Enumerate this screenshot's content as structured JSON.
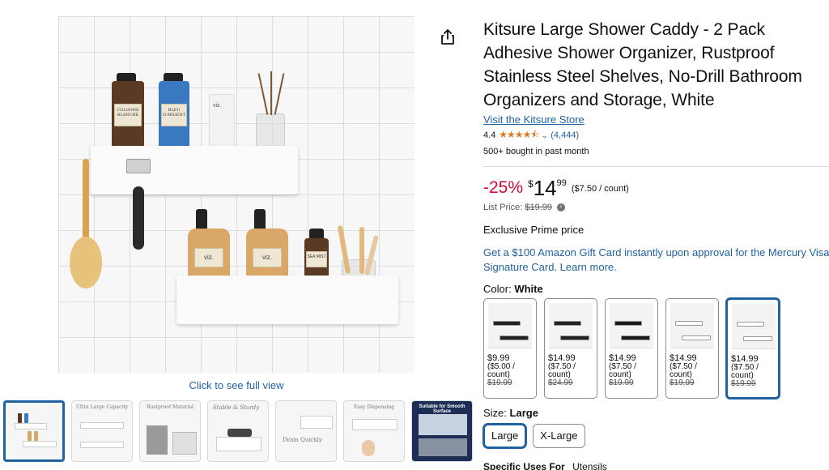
{
  "product": {
    "title": "Kitsure Large Shower Caddy - 2 Pack Adhesive Shower Organizer, Rustproof Stainless Steel Shelves, No-Drill Bathroom Organizers and Storage, White",
    "store_link": "Visit the Kitsure Store",
    "rating": "4.4",
    "stars_icon": "★★★★⯪",
    "rating_count": "(4,444)",
    "bought": "500+ bought in past month"
  },
  "price": {
    "discount": "-25%",
    "currency": "$",
    "whole": "14",
    "fraction": "99",
    "per_unit": "($7.50 / count)",
    "list_label": "List Price:",
    "list_value": "$19.99",
    "prime": "Exclusive Prime price"
  },
  "gift_card": "Get a $100 Amazon Gift Card instantly upon approval for the Mercury Visa Signature Card. Learn more.",
  "color": {
    "label": "Color:",
    "selected": "White",
    "options": [
      {
        "price": "$9.99",
        "unit": "($5.00 /",
        "unit2": "count)",
        "list": "$19.99",
        "shelf_color": "#222222"
      },
      {
        "price": "$14.99",
        "unit": "($7.50 /",
        "unit2": "count)",
        "list": "$24.99",
        "shelf_color": "#222222"
      },
      {
        "price": "$14.99",
        "unit": "($7.50 /",
        "unit2": "count)",
        "list": "$19.99",
        "shelf_color": "#1a1a1a"
      },
      {
        "price": "$14.99",
        "unit": "($7.50 /",
        "unit2": "count)",
        "list": "$19.99",
        "shelf_color": "#ffffff"
      },
      {
        "price": "$14.99",
        "unit": "($7.50 /",
        "unit2": "count)",
        "list": "$19.99",
        "shelf_color": "#ffffff"
      }
    ]
  },
  "size": {
    "label": "Size:",
    "selected": "Large",
    "options": [
      "Large",
      "X-Large"
    ]
  },
  "spec": {
    "label": "Specific Uses For",
    "value": "Utensils"
  },
  "gallery": {
    "full_view": "Click to see full view",
    "main_labels": {
      "b1": "COLOGNE BLANCHE",
      "b2": "BLEU D'ARGENT",
      "b3": "viz.",
      "b4": "viz.",
      "b5": "viz.",
      "b6": "SEA MIST"
    },
    "thumb_captions": [
      "",
      "Ultra Large Capacity",
      "Rustproof Material",
      "Stable & Sturdy",
      "Drain Quickly",
      "Easy Dispensing",
      "Suitable for Smooth Surface"
    ]
  },
  "colors": {
    "link": "#2162a1",
    "discount": "#cc0c39",
    "star": "#de7921",
    "selected_border": "#2162a1"
  }
}
